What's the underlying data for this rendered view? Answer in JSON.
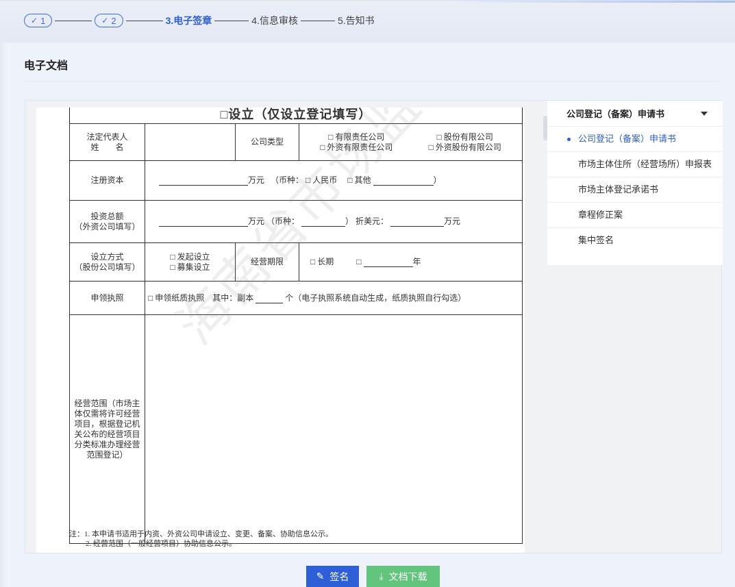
{
  "steps": {
    "step1": "1",
    "step2": "2",
    "step3": "3.电子签章",
    "step4": "4.信息审核",
    "step5": "5.告知书"
  },
  "page_title": "电子文档",
  "document": {
    "heading": "□设立（仅设立登记填写）",
    "rows": {
      "legal_rep_label_1": "法定代表人",
      "legal_rep_label_2": "姓　　名",
      "company_type_label": "公司类型",
      "company_type_opt1": "□ 有限责任公司",
      "company_type_opt2": "□ 股份有限公司",
      "company_type_opt3": "□ 外资有限责任公司",
      "company_type_opt4": "□ 外资股份有限公司",
      "reg_capital_label": "注册资本",
      "reg_capital_unit": "万元",
      "reg_capital_currency": "（币种：",
      "reg_capital_rmb": "□ 人民币",
      "reg_capital_other": "□ 其他",
      "reg_capital_close": "）",
      "invest_label_1": "投资总额",
      "invest_label_2": "（外资公司填写）",
      "invest_unit": "万元 （币种：",
      "invest_usd": "） 折美元：",
      "invest_usd_unit": "万元",
      "setup_label_1": "设立方式",
      "setup_label_2": "（股份公司填写）",
      "setup_opt1": "□ 发起设立",
      "setup_opt2": "□ 募集设立",
      "term_label": "经营期限",
      "term_long": "□ 长期",
      "term_box": "□",
      "term_year": "年",
      "license_label": "申领执照",
      "license_text_1": "□ 申领纸质执照　其中：副本",
      "license_text_2": "个（电子执照系统自动生成，纸质执照自行勾选）",
      "scope_label": "经营范围（市场主体仅需将许可经营项目，根据登记机关公布的经营项目分类标准办理经营范围登记）"
    },
    "note1": "注：1. 本申请书适用于内资、外资公司申请设立、变更、备案、协助信息公示。",
    "note2": "2. 经营范围（一般经营项目）协助信息公示。",
    "watermark": "海南省市场监督管理局"
  },
  "doc_list": {
    "header": "公司登记（备案）申请书",
    "items": [
      "公司登记（备案）申请书",
      "市场主体住所（经营场所）申报表",
      "市场主体登记承诺书",
      "章程修正案",
      "集中签名"
    ]
  },
  "buttons": {
    "sign": "签名",
    "download": "文档下载"
  },
  "colors": {
    "primary": "#2f5fd6",
    "download": "#62c47d"
  }
}
